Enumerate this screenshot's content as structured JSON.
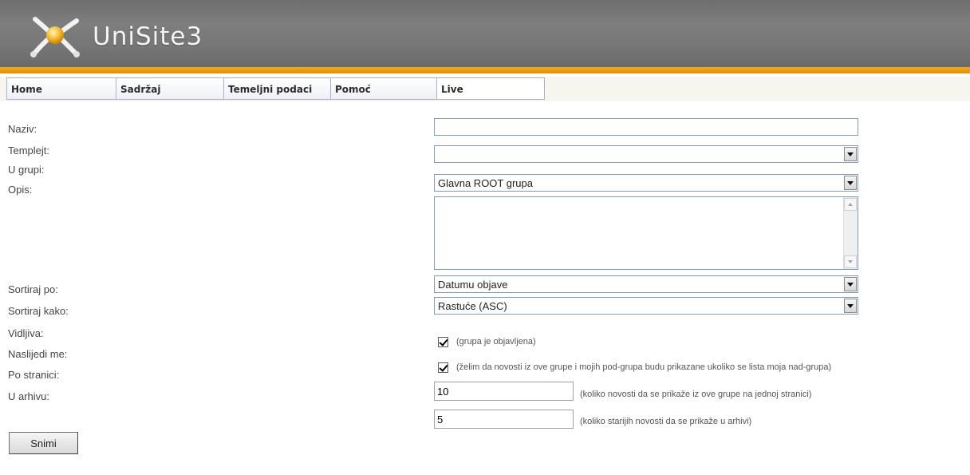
{
  "header": {
    "logo_text": "UniSite3",
    "colors": {
      "bar": "#777777",
      "stripe": "#f0a11a"
    },
    "logo_icon": "x-figure-logo-icon"
  },
  "nav": {
    "tabs": [
      {
        "label": "Home"
      },
      {
        "label": "Sadržaj"
      },
      {
        "label": "Temeljni podaci"
      },
      {
        "label": "Pomoć"
      },
      {
        "label": "Live"
      }
    ]
  },
  "form": {
    "naziv": {
      "label": "Naziv:",
      "value": ""
    },
    "templejt": {
      "label": "Templejt:",
      "value": ""
    },
    "u_grupi": {
      "label": "U grupi:",
      "value": "Glavna ROOT grupa"
    },
    "opis": {
      "label": "Opis:",
      "value": ""
    },
    "sortiraj_po": {
      "label": "Sortiraj po:",
      "value": "Datumu objave"
    },
    "sortiraj_kako": {
      "label": "Sortiraj kako:",
      "value": "Rastuće (ASC)"
    },
    "vidljiva": {
      "label": "Vidljiva:",
      "checked": true,
      "hint": "(grupa je objavljena)"
    },
    "naslijedi": {
      "label": "Naslijedi me:",
      "checked": true,
      "hint": "(želim da novosti iz ove grupe i mojih pod-grupa budu prikazane ukoliko se lista moja nad-grupa)"
    },
    "po_stranici": {
      "label": "Po stranici:",
      "value": "10",
      "hint": "(koliko novosti da se prikaže iz ove grupe na jednoj stranici)"
    },
    "u_arhivu": {
      "label": "U arhivu:",
      "value": "5",
      "hint": "(koliko starijih novosti da se prikaže u arhivi)"
    },
    "submit_label": "Snimi"
  }
}
